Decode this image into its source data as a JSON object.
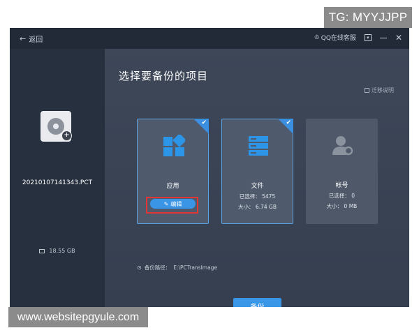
{
  "overlays": {
    "tg_label": "TG: MYYJJPP",
    "website": "www.websitepgyule.com"
  },
  "titlebar": {
    "back_label": "返回",
    "qq_service": "QQ在线客服",
    "controls": [
      "minimize-to-tray",
      "minimize",
      "close"
    ]
  },
  "left_panel": {
    "file_name": "20210107141343.PCT",
    "storage_size": "18.55 GB"
  },
  "main": {
    "title": "选择要备份的项目",
    "migrate_note": "迁移说明",
    "cards": [
      {
        "id": "apps",
        "title": "应用",
        "selected": true,
        "edit_label": "编辑"
      },
      {
        "id": "files",
        "title": "文件",
        "selected": true,
        "selected_label": "已选择：",
        "selected_value": "5475",
        "size_label": "大小：",
        "size_value": "6.74 GB"
      },
      {
        "id": "accounts",
        "title": "帐号",
        "selected": false,
        "selected_label": "已选择：",
        "selected_value": "0",
        "size_label": "大小：",
        "size_value": "0 MB"
      }
    ],
    "path_label": "备份路径：",
    "path_value": "E:\\PCTransImage",
    "backup_button": "备份"
  },
  "colors": {
    "accent": "#3a97e8",
    "background": "#222a38",
    "panel": "#3d4758",
    "highlight": "#e23535"
  }
}
